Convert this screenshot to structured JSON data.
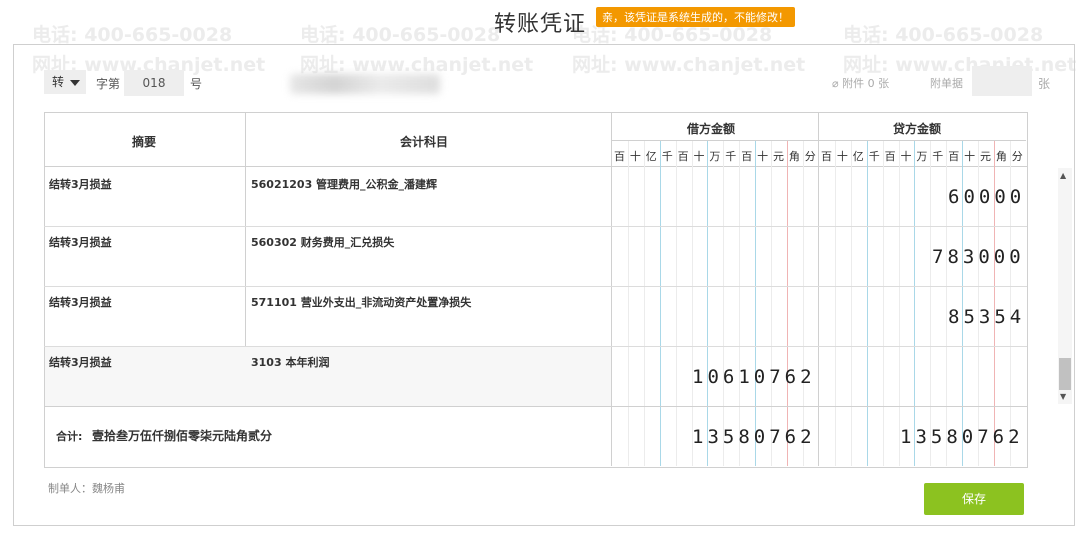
{
  "header": {
    "title": "转账凭证",
    "notice": "亲，该凭证是系统生成的，不能修改！"
  },
  "toolbar": {
    "voucher_type": "转",
    "zi_label": "字第",
    "voucher_number": "018",
    "hao_label": "号",
    "attachment_label": "附件 0 张",
    "attach_doc_label": "附单据",
    "zhang_label": "张"
  },
  "table": {
    "headers": {
      "summary": "摘要",
      "account": "会计科目",
      "debit": "借方金额",
      "credit": "贷方金额"
    },
    "digit_units": [
      "百",
      "十",
      "亿",
      "千",
      "百",
      "十",
      "万",
      "千",
      "百",
      "十",
      "元",
      "角",
      "分"
    ],
    "rows": [
      {
        "summary": "结转3月损益",
        "account": "56021203 管理费用_公积金_潘建辉",
        "debit": "",
        "credit": "60000"
      },
      {
        "summary": "结转3月损益",
        "account": "560302 财务费用_汇兑损失",
        "debit": "",
        "credit": "783000"
      },
      {
        "summary": "结转3月损益",
        "account": "571101 营业外支出_非流动资产处置净损失",
        "debit": "",
        "credit": "85354"
      },
      {
        "summary": "结转3月损益",
        "account": "3103 本年利润",
        "debit": "10610762",
        "credit": ""
      }
    ],
    "total": {
      "label": "合计:",
      "amount_words": "壹拾叁万伍仟捌佰零柒元陆角贰分",
      "debit": "13580762",
      "credit": "13580762"
    }
  },
  "footer": {
    "maker": "制单人：魏杨甫",
    "save_label": "保存"
  },
  "watermark": {
    "phone": "电话: 400-665-0028",
    "site": "网址: www.chanjet.net"
  },
  "colors": {
    "notice_bg": "#f39800",
    "save_bg": "#8cc220",
    "grid_blue": "#a9d8e8",
    "grid_red": "#f0b4b4"
  }
}
